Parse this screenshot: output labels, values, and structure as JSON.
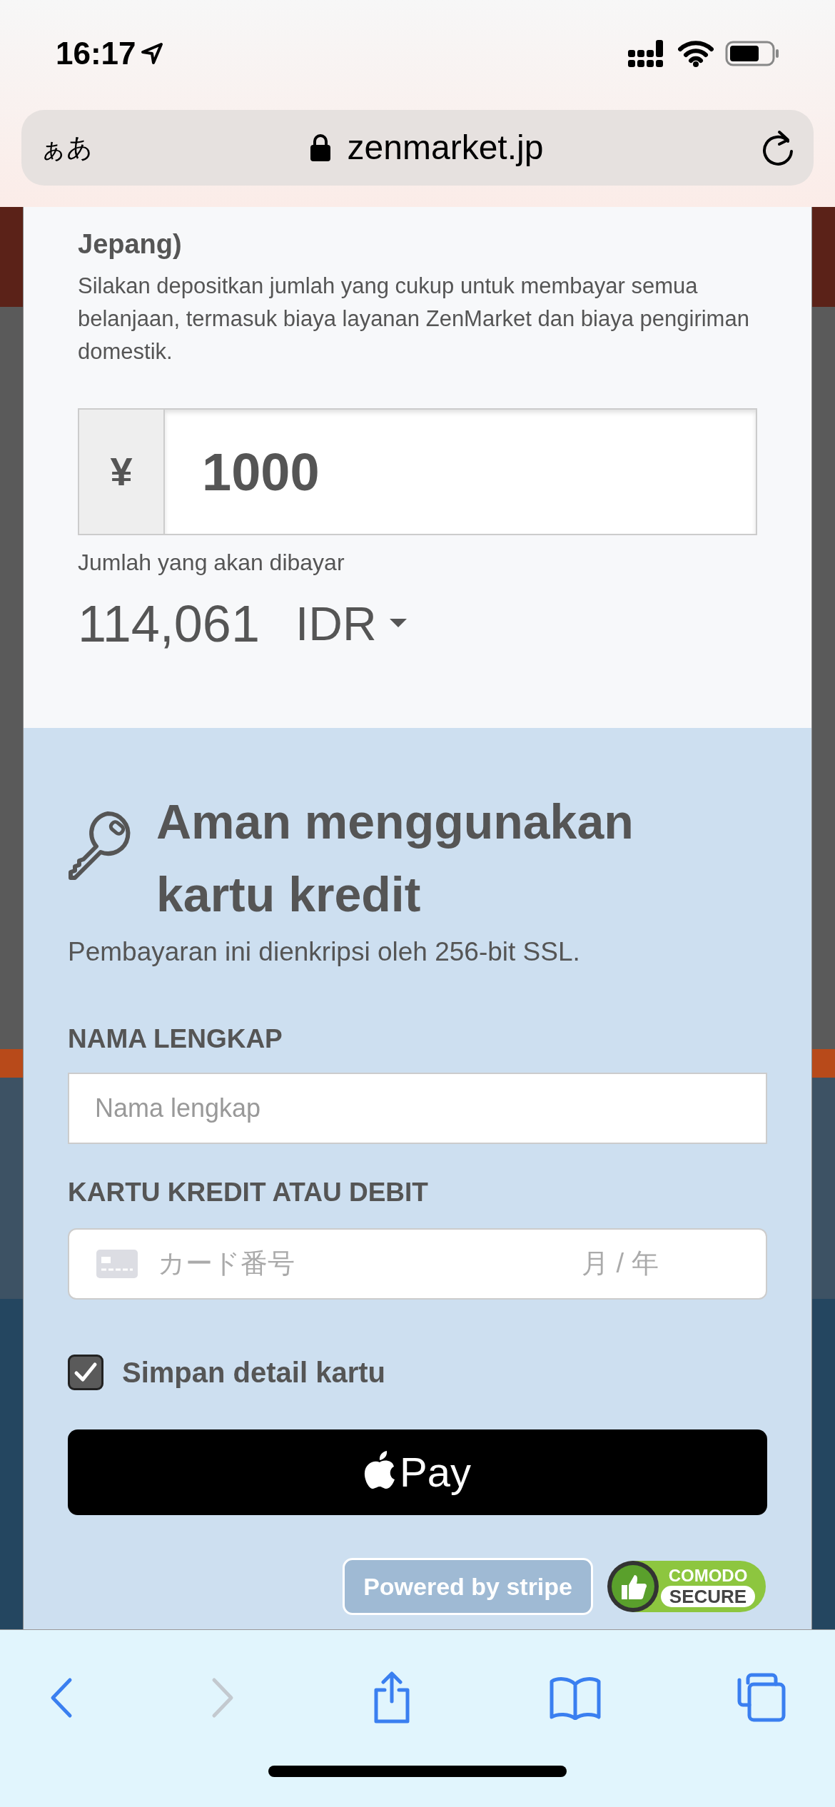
{
  "status_bar": {
    "time": "16:17"
  },
  "browser": {
    "text_size_button": "ぁあ",
    "url": "zenmarket.jp"
  },
  "deposit": {
    "heading": "Jepang)",
    "description": "Silakan depositkan jumlah yang cukup untuk membayar semua belanjaan, termasuk biaya layanan ZenMarket dan biaya pengiriman domestik.",
    "currency_symbol": "¥",
    "amount": "1000",
    "pay_label": "Jumlah yang akan dibayar",
    "pay_amount": "114,061",
    "pay_currency": "IDR"
  },
  "payment": {
    "title": "Aman menggunakan kartu kredit",
    "subtitle": "Pembayaran ini dienkripsi oleh 256-bit SSL.",
    "fields": [
      {
        "kind": "text",
        "label": "NAMA LENGKAP",
        "placeholder": "Nama lengkap"
      },
      {
        "kind": "card",
        "label": "KARTU KREDIT ATAU DEBIT",
        "placeholder": "カード番号",
        "expiry_placeholder": "月 / 年"
      }
    ],
    "save_card": {
      "label": "Simpan detail kartu",
      "checked": true
    },
    "apple_pay": {
      "label": "Pay"
    },
    "badges": [
      {
        "kind": "stripe",
        "text": "Powered by **stripe**"
      },
      {
        "kind": "comodo",
        "line1": "COMODO",
        "line2": "SECURE"
      }
    ]
  },
  "toolbar": [
    {
      "kind": "back",
      "disabled": false
    },
    {
      "kind": "forward",
      "disabled": true
    },
    {
      "kind": "share",
      "disabled": false
    },
    {
      "kind": "bookmarks",
      "disabled": false
    },
    {
      "kind": "tabs",
      "disabled": false
    }
  ]
}
